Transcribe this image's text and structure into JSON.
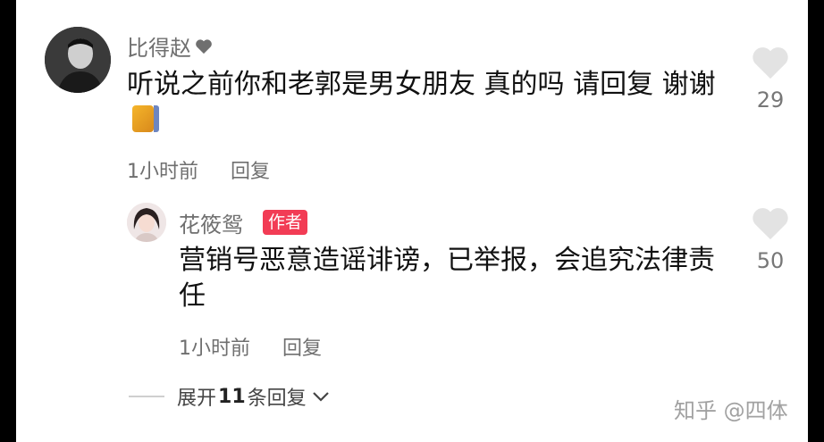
{
  "comment": {
    "username": "比得赵",
    "text": "听说之前你和老郭是男女朋友 真的吗 请回复 谢谢",
    "time": "1小时前",
    "reply_label": "回复",
    "like_count": "29"
  },
  "reply": {
    "username": "花筱鸳",
    "badge": "作者",
    "text": "营销号恶意造谣诽谤，已举报，会追究法律责任",
    "time": "1小时前",
    "reply_label": "回复",
    "like_count": "50"
  },
  "expand": {
    "prefix": "展开",
    "count": "11",
    "suffix": "条回复"
  },
  "watermark": "知乎 @四体",
  "colors": {
    "badge": "#f23c55",
    "secondary_text": "#6f6f6f",
    "heart": "#e3e3e3"
  }
}
